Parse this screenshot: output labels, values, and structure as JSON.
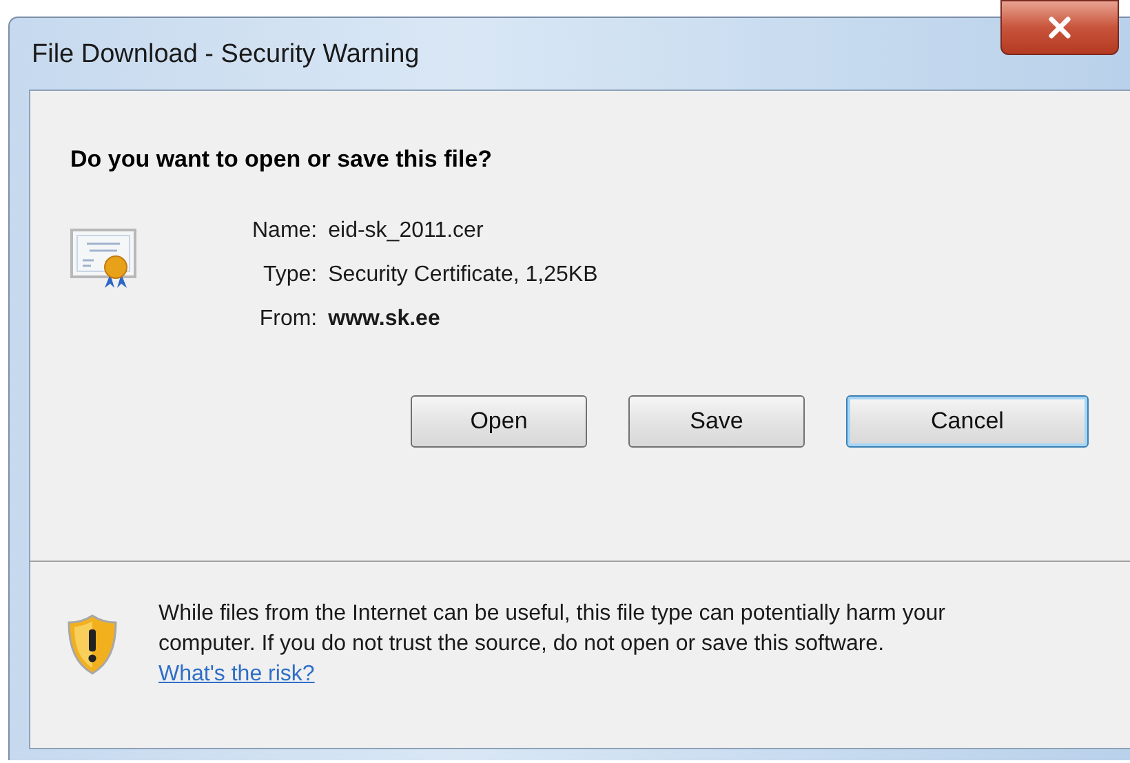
{
  "window": {
    "title": "File Download - Security Warning"
  },
  "heading": "Do you want to open or save this file?",
  "file_info": [
    {
      "label": "Name:",
      "value": "eid-sk_2011.cer",
      "bold": false
    },
    {
      "label": "Type:",
      "value": "Security Certificate, 1,25KB",
      "bold": false
    },
    {
      "label": "From:",
      "value": "www.sk.ee",
      "bold": true
    }
  ],
  "buttons": [
    {
      "label": "Open",
      "focused": false
    },
    {
      "label": "Save",
      "focused": false
    },
    {
      "label": "Cancel",
      "focused": true
    }
  ],
  "warning": {
    "text": "While files from the Internet can be useful, this file type can potentially harm your computer. If you do not trust the source, do not open or save this software.",
    "link": "What's the risk?"
  }
}
